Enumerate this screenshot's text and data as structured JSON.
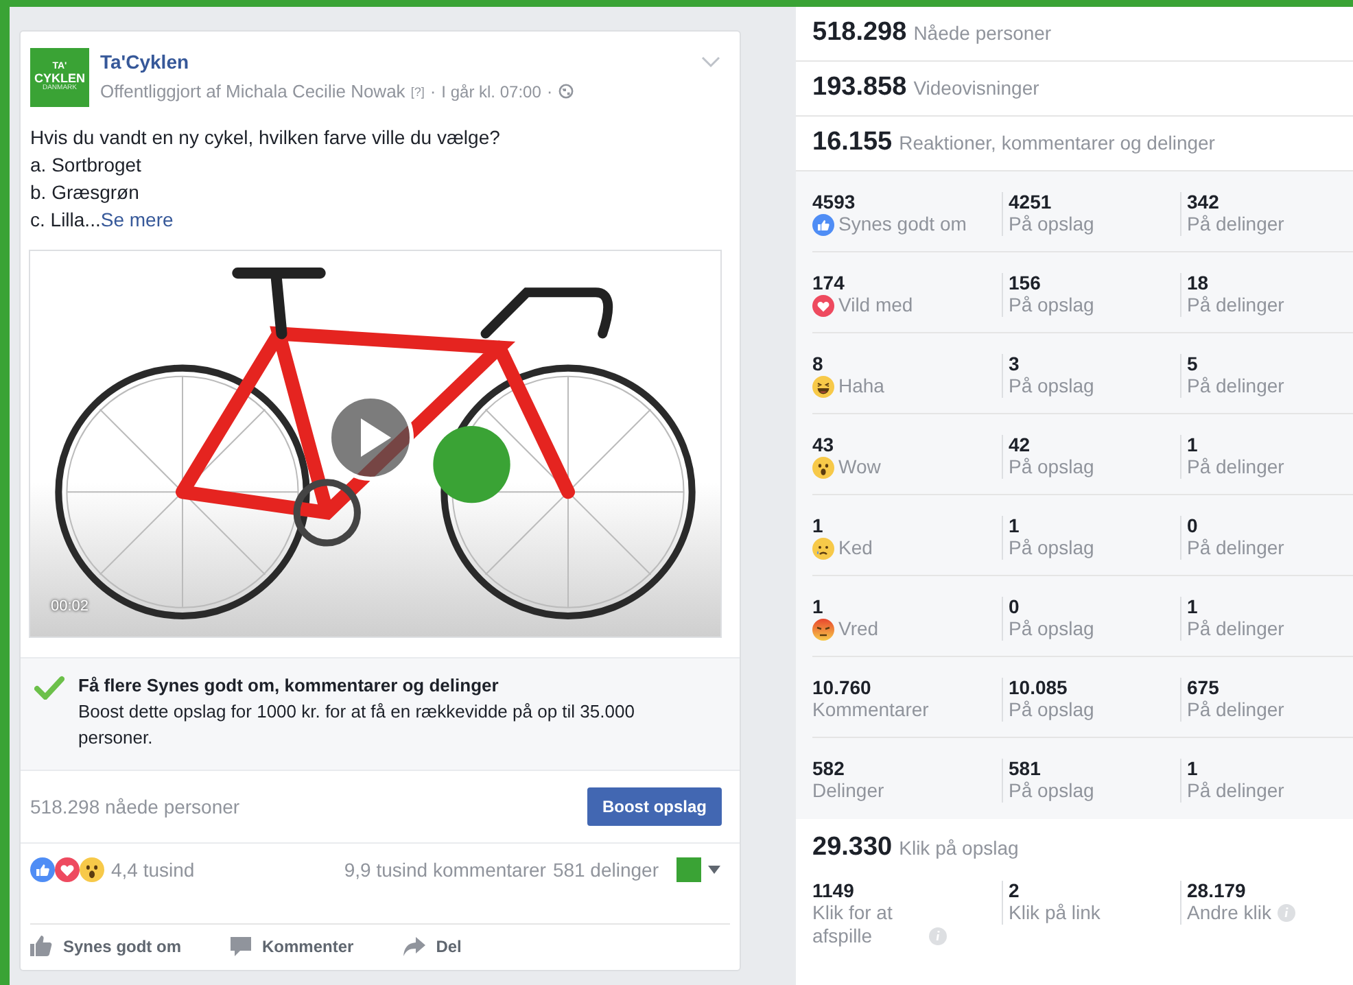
{
  "post": {
    "page_name": "Ta'Cyklen",
    "logo": {
      "line_1": "TA'",
      "line_2": "CYKLEN",
      "line_3": "DANMARK"
    },
    "byline": "Offentliggjort af Michala Cecilie Nowak",
    "help_mark": "[?]",
    "separator": "·",
    "time": "I går kl. 07:00",
    "text_lines": [
      "Hvis du vandt en ny cykel, hvilken farve ville du vælge?",
      "a. Sortbroget",
      "b. Græsgrøn",
      "c. Lilla..."
    ],
    "see_more": "Se mere",
    "video": {
      "timestamp": "00:02"
    },
    "boost_tip": {
      "title": "Få flere Synes godt om, kommentarer og delinger",
      "body": "Boost dette opslag for 1000 kr. for at få en rækkevidde på op til 35.000 personer."
    },
    "reach": "518.298 nåede personer",
    "boost_button": "Boost opslag",
    "reaction_count": "4,4 tusind",
    "comments": "9,9 tusind kommentarer",
    "shares": "581 delinger",
    "actions": [
      {
        "kind": "like",
        "label": "Synes godt om"
      },
      {
        "kind": "comment",
        "label": "Kommenter"
      },
      {
        "kind": "share",
        "label": "Del"
      }
    ]
  },
  "insights": {
    "summary": [
      {
        "value": "518.298",
        "label": "Nåede personer"
      },
      {
        "value": "193.858",
        "label": "Videovisninger"
      },
      {
        "value": "16.155",
        "label": "Reaktioner, kommentarer og delinger"
      }
    ],
    "rows": [
      {
        "kind": "like",
        "total": "4593",
        "label": "Synes godt om",
        "on_post": "4251",
        "on_post_label": "På opslag",
        "on_shares": "342",
        "on_shares_label": "På delinger"
      },
      {
        "kind": "love",
        "total": "174",
        "label": "Vild med",
        "on_post": "156",
        "on_post_label": "På opslag",
        "on_shares": "18",
        "on_shares_label": "På delinger"
      },
      {
        "kind": "haha",
        "total": "8",
        "label": "Haha",
        "on_post": "3",
        "on_post_label": "På opslag",
        "on_shares": "5",
        "on_shares_label": "På delinger"
      },
      {
        "kind": "wow",
        "total": "43",
        "label": "Wow",
        "on_post": "42",
        "on_post_label": "På opslag",
        "on_shares": "1",
        "on_shares_label": "På delinger"
      },
      {
        "kind": "sad",
        "total": "1",
        "label": "Ked",
        "on_post": "1",
        "on_post_label": "På opslag",
        "on_shares": "0",
        "on_shares_label": "På delinger"
      },
      {
        "kind": "angry",
        "total": "1",
        "label": "Vred",
        "on_post": "0",
        "on_post_label": "På opslag",
        "on_shares": "1",
        "on_shares_label": "På delinger"
      },
      {
        "kind": "plain",
        "total": "10.760",
        "label": "Kommentarer",
        "on_post": "10.085",
        "on_post_label": "På opslag",
        "on_shares": "675",
        "on_shares_label": "På delinger"
      },
      {
        "kind": "plain",
        "total": "582",
        "label": "Delinger",
        "on_post": "581",
        "on_post_label": "På opslag",
        "on_shares": "1",
        "on_shares_label": "På delinger"
      }
    ],
    "clicks": {
      "value": "29.330",
      "label": "Klik på opslag",
      "items": [
        {
          "value": "1149",
          "label": "Klik for at afspille",
          "info": true
        },
        {
          "value": "2",
          "label": "Klik på link",
          "info": false
        },
        {
          "value": "28.179",
          "label": "Andre klik",
          "info": true
        }
      ]
    }
  }
}
